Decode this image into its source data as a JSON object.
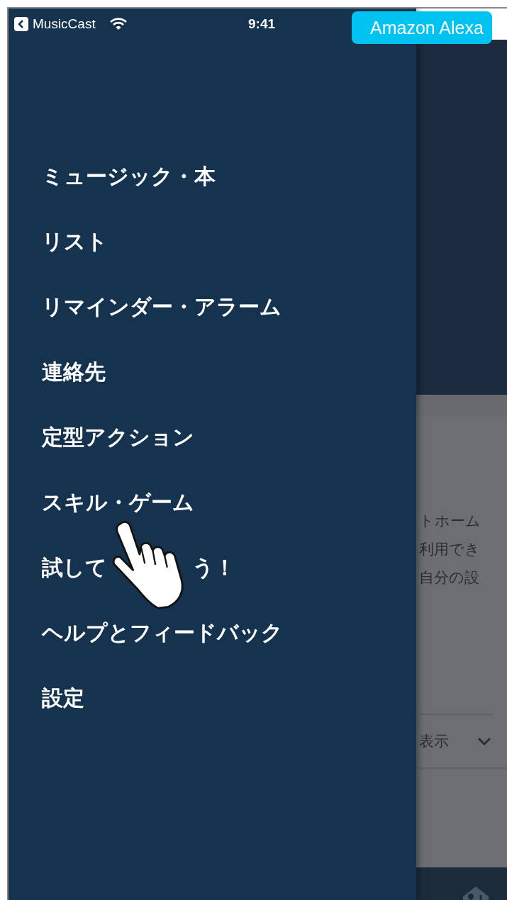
{
  "status_bar": {
    "back_app": "MusicCast",
    "time": "9:41",
    "alexa_badge": "Amazon Alexa"
  },
  "menu": {
    "items": [
      {
        "label": "ミュージック・本"
      },
      {
        "label": "リスト"
      },
      {
        "label": "リマインダー・アラーム"
      },
      {
        "label": "連絡先"
      },
      {
        "label": "定型アクション"
      },
      {
        "label": "スキル・ゲーム"
      },
      {
        "kind": "covered",
        "visible_parts": [
          "試して",
          "う！"
        ]
      },
      {
        "label": "ヘルプとフィードバック"
      },
      {
        "label": "設定"
      }
    ]
  },
  "background": {
    "text_lines": [
      "トホーム",
      "利用でき",
      "自分の設"
    ],
    "dropdown": {
      "label": "表示"
    }
  }
}
